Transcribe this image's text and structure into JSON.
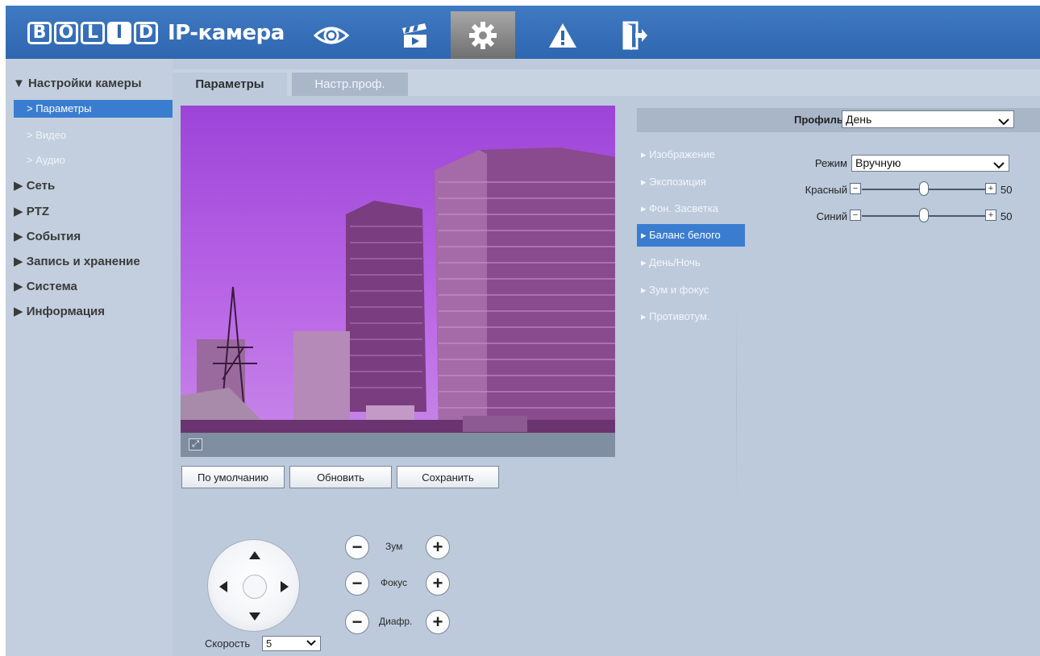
{
  "header": {
    "brand_letters": [
      "B",
      "O",
      "L",
      "I",
      "D"
    ],
    "brand": "BOLID",
    "product": "IP-камера",
    "nav_icons": [
      "eye-icon",
      "clapperboard-icon",
      "gear-icon",
      "warning-icon",
      "logout-icon"
    ],
    "active_icon": "gear-icon"
  },
  "sidebar": {
    "section_title": "▼ Настройки камеры",
    "sub_items": [
      {
        "label": "> Параметры",
        "active": true
      },
      {
        "label": "> Видео",
        "active": false
      },
      {
        "label": "> Аудио",
        "active": false
      }
    ],
    "items": [
      {
        "label": "▶ Сеть"
      },
      {
        "label": "▶ PTZ"
      },
      {
        "label": "▶ События"
      },
      {
        "label": "▶ Запись и хранение"
      },
      {
        "label": "▶ Система"
      },
      {
        "label": "▶ Информация"
      }
    ]
  },
  "tabs": [
    {
      "label": "Параметры",
      "active": true
    },
    {
      "label": "Настр.проф.",
      "active": false
    }
  ],
  "buttons": {
    "default": "По умолчанию",
    "refresh": "Обновить",
    "save": "Сохранить"
  },
  "ptz": {
    "zoom": "Зум",
    "focus": "Фокус",
    "iris": "Диафр.",
    "speed_label": "Скорость",
    "speed_value": "5"
  },
  "profile": {
    "label": "Профиль",
    "value": "День"
  },
  "menu": [
    {
      "label": "▸ Изображение",
      "active": false
    },
    {
      "label": "▸ Экспозиция",
      "active": false
    },
    {
      "label": "▸ Фон. Засветка",
      "active": false
    },
    {
      "label": "▸ Баланс белого",
      "active": true
    },
    {
      "label": "▸ День/Ночь",
      "active": false
    },
    {
      "label": "▸ Зум и фокус",
      "active": false
    },
    {
      "label": "▸ Противотум.",
      "active": false
    }
  ],
  "white_balance": {
    "mode_label": "Режим",
    "mode_value": "Вручную",
    "red_label": "Красный",
    "red_value": "50",
    "red_fraction": 0.5,
    "blue_label": "Синий",
    "blue_value": "50",
    "blue_fraction": 0.5
  },
  "colors": {
    "header": "#2f66b0",
    "accent": "#3a7dd0",
    "panel": "#bccadb"
  }
}
